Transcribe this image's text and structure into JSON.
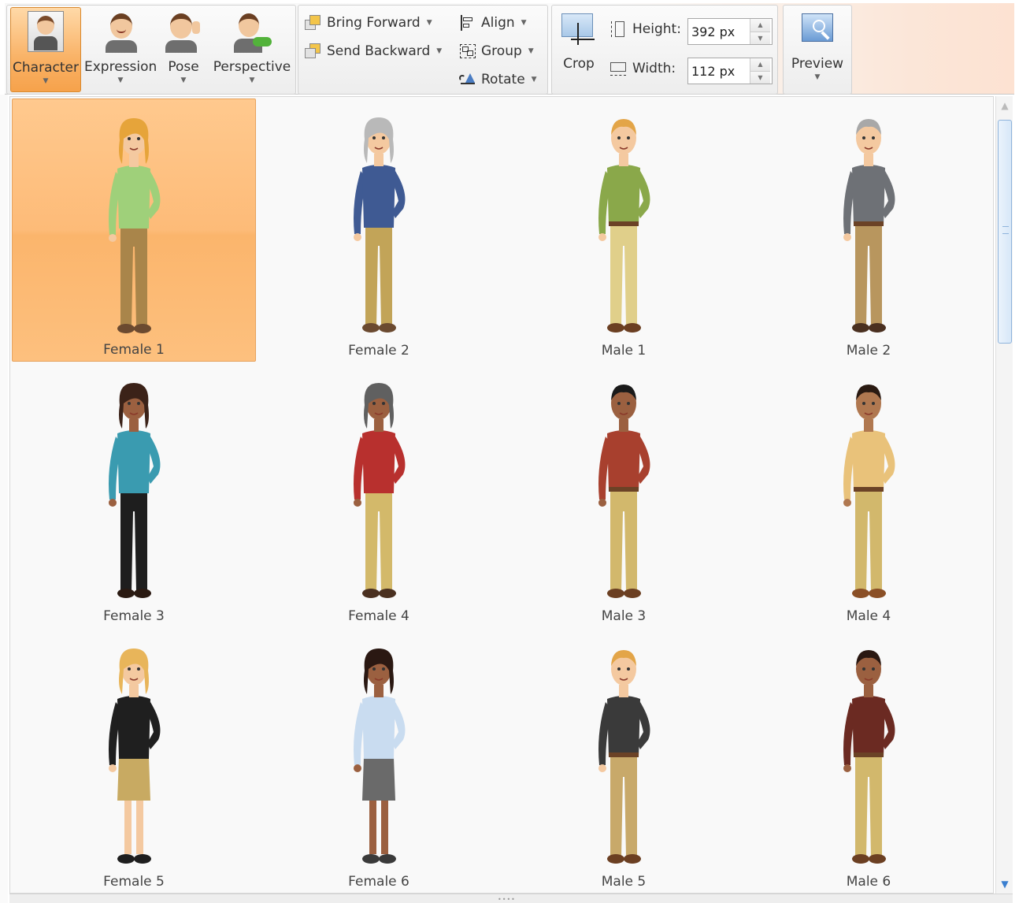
{
  "ribbon": {
    "character": {
      "label": "Character",
      "icon": "character-icon"
    },
    "expression": {
      "label": "Expression",
      "icon": "expression-icon"
    },
    "pose": {
      "label": "Pose",
      "icon": "pose-icon"
    },
    "perspective": {
      "label": "Perspective",
      "icon": "perspective-icon"
    },
    "bring_forward": {
      "label": "Bring Forward",
      "icon": "bring-forward-icon"
    },
    "send_backward": {
      "label": "Send Backward",
      "icon": "send-backward-icon"
    },
    "align": {
      "label": "Align",
      "icon": "align-icon"
    },
    "group": {
      "label": "Group",
      "icon": "group-icon"
    },
    "rotate": {
      "label": "Rotate",
      "icon": "rotate-icon"
    },
    "crop": {
      "label": "Crop",
      "icon": "crop-icon"
    },
    "height": {
      "label": "Height:",
      "value": "392 px"
    },
    "width": {
      "label": "Width:",
      "value": "112 px"
    },
    "preview": {
      "label": "Preview",
      "icon": "preview-icon"
    }
  },
  "gallery": {
    "selected": "Female 1",
    "items": [
      {
        "name": "Female 1",
        "hair": "#e6a43a",
        "skin": "#f4c9a0",
        "shirt": "#9fd07a",
        "pants": "#a9854a",
        "shoes": "#6b4a30",
        "gender": "f"
      },
      {
        "name": "Female 2",
        "hair": "#b9b9b9",
        "skin": "#f4c9a0",
        "shirt": "#3f5a93",
        "pants": "#c2a458",
        "shoes": "#6b4a30",
        "gender": "f"
      },
      {
        "name": "Male 1",
        "hair": "#e3a548",
        "skin": "#f4c9a0",
        "shirt": "#8aa84a",
        "pants": "#e0cf8a",
        "shoes": "#6b3f22",
        "gender": "m"
      },
      {
        "name": "Male 2",
        "hair": "#a8a8a8",
        "skin": "#f4c9a0",
        "shirt": "#6e7176",
        "pants": "#b8965e",
        "shoes": "#4a3020",
        "gender": "m"
      },
      {
        "name": "Female 3",
        "hair": "#3b2218",
        "skin": "#9b6040",
        "shirt": "#3a9bb0",
        "pants": "#1e1e1e",
        "shoes": "#2a1a12",
        "gender": "f"
      },
      {
        "name": "Female 4",
        "hair": "#606060",
        "skin": "#9b6040",
        "shirt": "#b8302e",
        "pants": "#d3b96a",
        "shoes": "#4a3020",
        "gender": "f"
      },
      {
        "name": "Male 3",
        "hair": "#1a1a1a",
        "skin": "#9b6040",
        "shirt": "#a8402e",
        "pants": "#d2b86c",
        "shoes": "#6b3f22",
        "gender": "m"
      },
      {
        "name": "Male 4",
        "hair": "#2a1a12",
        "skin": "#b07850",
        "shirt": "#e9c27a",
        "pants": "#d2b86c",
        "shoes": "#8a4f26",
        "gender": "m"
      },
      {
        "name": "Female 5",
        "hair": "#e8b55a",
        "skin": "#f4c9a0",
        "shirt": "#1f1f1f",
        "pants": "#c8aa62",
        "shoes": "#1e1e1e",
        "gender": "f"
      },
      {
        "name": "Female 6",
        "hair": "#2a1812",
        "skin": "#9b6040",
        "shirt": "#c9dcf0",
        "pants": "#6a6a6a",
        "shoes": "#3a3a3a",
        "gender": "f"
      },
      {
        "name": "Male 5",
        "hair": "#e3a548",
        "skin": "#f4c9a0",
        "shirt": "#3a3a3a",
        "pants": "#c8a96a",
        "shoes": "#6b3f22",
        "gender": "m"
      },
      {
        "name": "Male 6",
        "hair": "#2a1812",
        "skin": "#9b6040",
        "shirt": "#6b2a22",
        "pants": "#d2b86c",
        "shoes": "#6b3f22",
        "gender": "m"
      }
    ]
  }
}
